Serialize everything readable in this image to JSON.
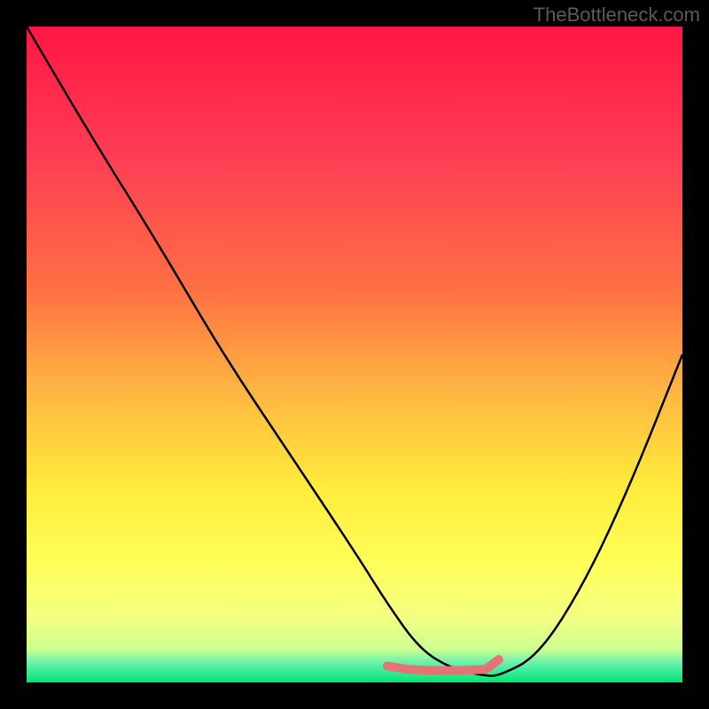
{
  "watermark": "TheBottleneck.com",
  "chart_data": {
    "type": "line",
    "title": "",
    "xlabel": "",
    "ylabel": "",
    "xlim": [
      0,
      100
    ],
    "ylim": [
      0,
      100
    ],
    "gradient_stops": [
      {
        "offset": 0,
        "color": "#ff1744"
      },
      {
        "offset": 20,
        "color": "#ff3d55"
      },
      {
        "offset": 40,
        "color": "#ff7043"
      },
      {
        "offset": 55,
        "color": "#ffb342"
      },
      {
        "offset": 70,
        "color": "#ffeb3b"
      },
      {
        "offset": 82,
        "color": "#ffff59"
      },
      {
        "offset": 90,
        "color": "#f4ff81"
      },
      {
        "offset": 95,
        "color": "#ccff90"
      },
      {
        "offset": 97,
        "color": "#69f0ae"
      },
      {
        "offset": 100,
        "color": "#00e676"
      }
    ],
    "curve": {
      "x": [
        0,
        10,
        20,
        30,
        40,
        50,
        55,
        60,
        65,
        70,
        72,
        78,
        85,
        92,
        100
      ],
      "y": [
        100,
        83,
        67,
        50,
        35,
        20,
        12,
        5,
        2,
        1,
        1,
        4,
        15,
        30,
        50
      ]
    },
    "highlight": {
      "color": "#e57373",
      "x": [
        55,
        58,
        62,
        66,
        70,
        72
      ],
      "y": [
        2.5,
        2,
        1.8,
        1.8,
        2,
        3.5
      ]
    }
  }
}
